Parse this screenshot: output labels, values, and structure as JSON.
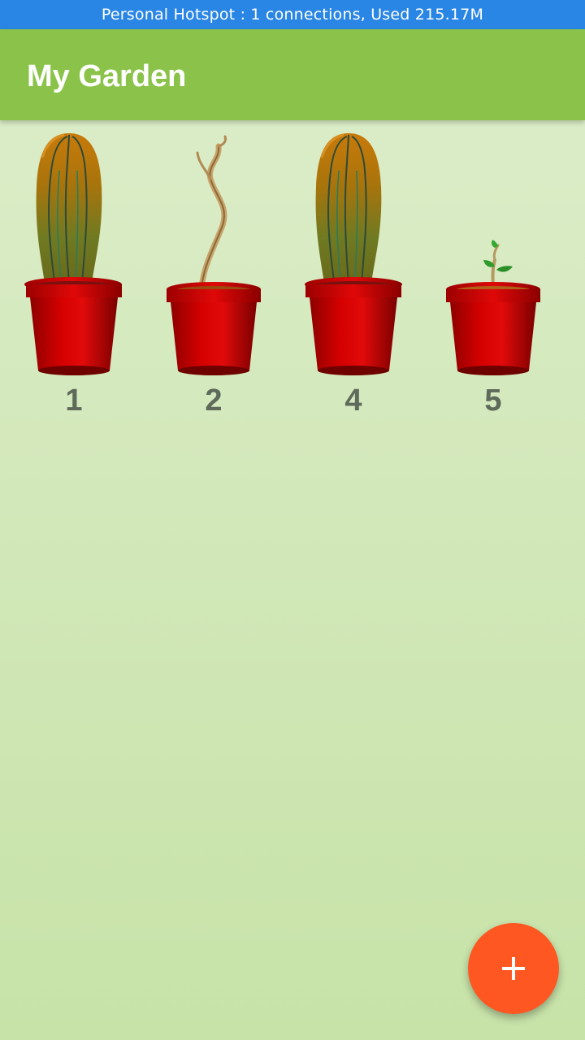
{
  "status_bar": {
    "text": "Personal Hotspot : 1 connections, Used 215.17M"
  },
  "app_bar": {
    "title": "My Garden"
  },
  "plants": [
    {
      "label": "1",
      "icon": "cactus-icon"
    },
    {
      "label": "2",
      "icon": "wilted-vine-icon"
    },
    {
      "label": "4",
      "icon": "cactus-icon"
    },
    {
      "label": "5",
      "icon": "sprout-icon"
    }
  ],
  "fab": {
    "icon": "plus-icon",
    "color": "#ff5722"
  },
  "colors": {
    "status_bar": "#2a86e4",
    "app_bar": "#8bc34a",
    "pot": "#cc0000",
    "label_text": "#5e6a5a"
  }
}
